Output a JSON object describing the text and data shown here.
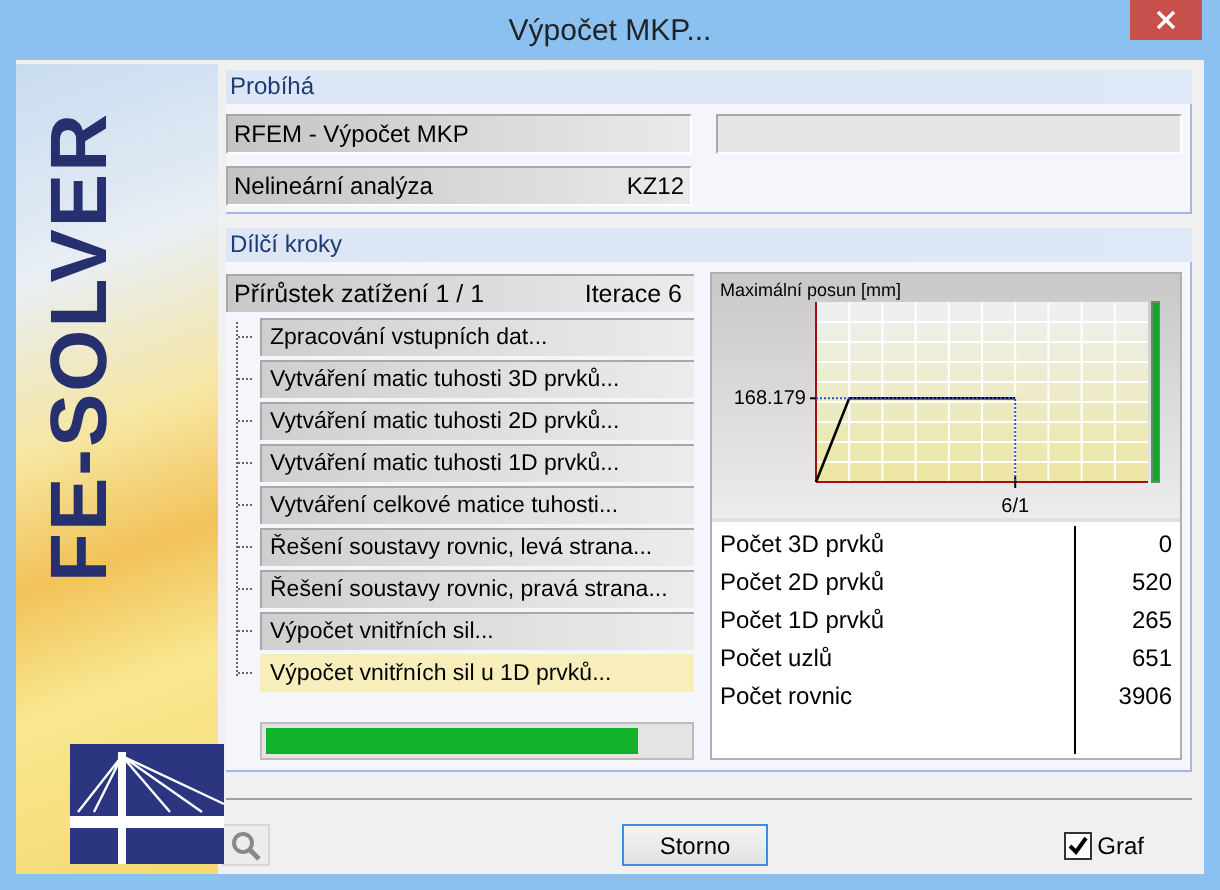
{
  "window": {
    "title": "Výpočet MKP..."
  },
  "banner": {
    "text": "FE-SOLVER"
  },
  "running": {
    "title": "Probíhá",
    "program": "RFEM - Výpočet MKP",
    "analysis": "Nelineární analýza",
    "load_combination": "KZ12"
  },
  "substeps": {
    "title": "Dílčí kroky",
    "increment": "Přírůstek zatížení 1 / 1",
    "iteration": "Iterace 6",
    "steps": [
      {
        "label": "Zpracování vstupních dat...",
        "current": false
      },
      {
        "label": "Vytváření matic tuhosti 3D prvků...",
        "current": false
      },
      {
        "label": "Vytváření matic tuhosti 2D prvků...",
        "current": false
      },
      {
        "label": "Vytváření matic tuhosti 1D prvků...",
        "current": false
      },
      {
        "label": "Vytváření celkové matice tuhosti...",
        "current": false
      },
      {
        "label": "Řešení soustavy rovnic, levá strana...",
        "current": false
      },
      {
        "label": "Řešení soustavy rovnic, pravá strana...",
        "current": false
      },
      {
        "label": "Výpočet vnitřních sil...",
        "current": false
      },
      {
        "label": "Výpočet vnitřních sil u 1D prvků...",
        "current": true
      }
    ],
    "progress": {
      "level": 0.88
    }
  },
  "chart": {
    "title": "Maximální posun [mm]",
    "y_marker": "168.179",
    "x_marker": "6/1"
  },
  "statistics": [
    {
      "label": "Počet 3D prvků",
      "value": "0"
    },
    {
      "label": "Počet 2D prvků",
      "value": "520"
    },
    {
      "label": "Počet 1D prvků",
      "value": "265"
    },
    {
      "label": "Počet uzlů",
      "value": "651"
    },
    {
      "label": "Počet rovnic",
      "value": "3906"
    }
  ],
  "buttons": {
    "cancel": "Storno"
  },
  "graph_checkbox": {
    "label": "Graf",
    "checked": true
  }
}
